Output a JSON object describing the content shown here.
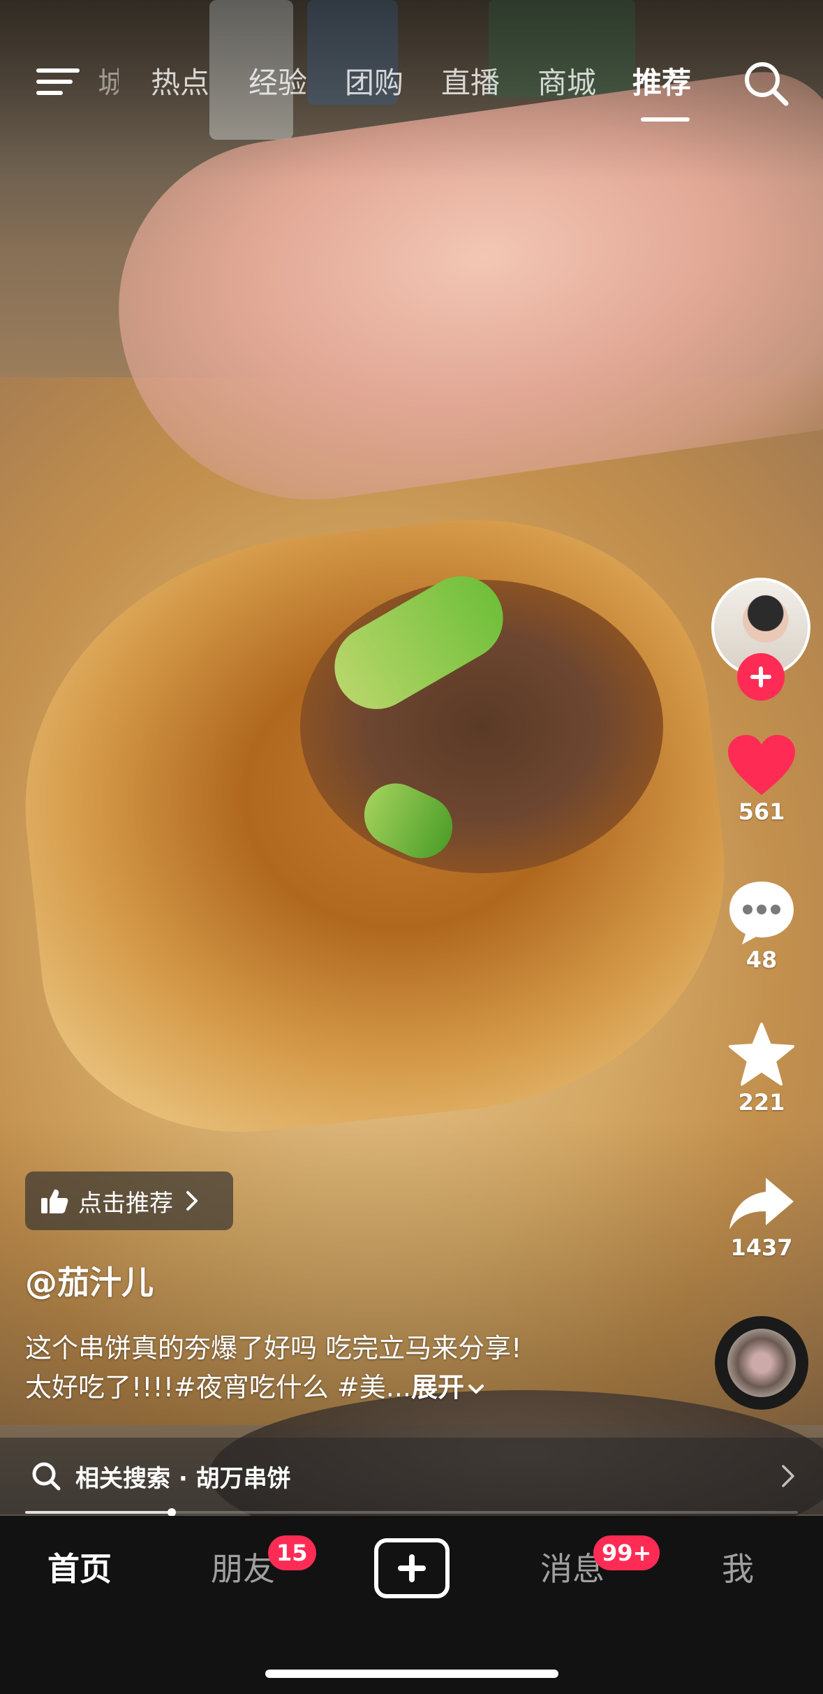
{
  "topnav": {
    "tabs": [
      {
        "label": "城"
      },
      {
        "label": "热点"
      },
      {
        "label": "经验"
      },
      {
        "label": "团购"
      },
      {
        "label": "直播"
      },
      {
        "label": "商城"
      },
      {
        "label": "推荐",
        "active": true
      }
    ],
    "icons": {
      "menu": "menu-icon",
      "search": "search-icon"
    }
  },
  "actions": {
    "like_count": "561",
    "comment_count": "48",
    "favorite_count": "221",
    "share_count": "1437",
    "like_color": "#fe2c55",
    "follow_color": "#fe2c55"
  },
  "video": {
    "recommend_label": "点击推荐",
    "author": "@茄汁儿",
    "caption_line1": "这个串饼真的夯爆了好吗 吃完立马来分享!",
    "caption_line2": "太好吃了!!!!#夜宵吃什么 #美...",
    "expand_label": "展开",
    "progress": 0.19
  },
  "related_search": {
    "label": "相关搜索 · 胡万串饼"
  },
  "bottombar": {
    "home": "首页",
    "friends": "朋友",
    "friends_badge": "15",
    "messages": "消息",
    "messages_badge": "99+",
    "me": "我"
  }
}
